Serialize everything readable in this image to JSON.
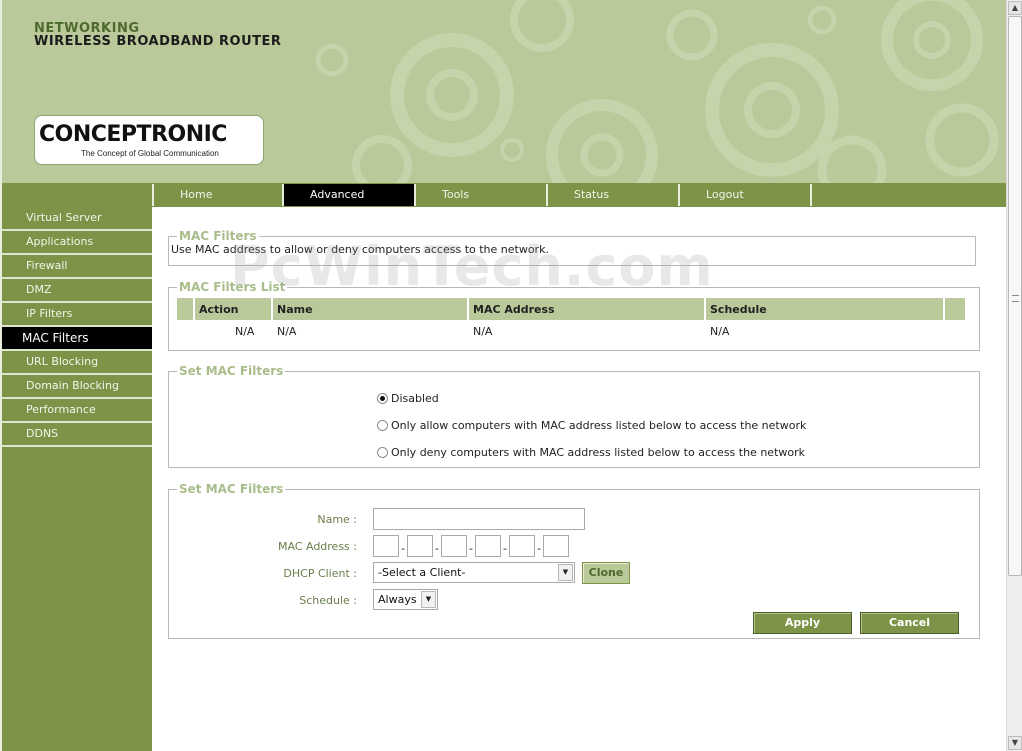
{
  "header": {
    "line1": "NETWORKING",
    "line2": "WIRELESS BROADBAND ROUTER",
    "logo_name": "CONCEPTRONIC",
    "logo_tagline": "The Concept of Global Communication"
  },
  "topnav": [
    "Home",
    "Advanced",
    "Tools",
    "Status",
    "Logout"
  ],
  "topnav_active": "Advanced",
  "sidebar": {
    "items": [
      "Virtual Server",
      "Applications",
      "Firewall",
      "DMZ",
      "IP Filters",
      "MAC Filters",
      "URL Blocking",
      "Domain Blocking",
      "Performance",
      "DDNS"
    ],
    "active": "MAC Filters"
  },
  "watermark": "PcWinTech.com",
  "mac_filters": {
    "legend": "MAC Filters",
    "description": "Use MAC address to allow or deny computers access to the network."
  },
  "list": {
    "legend": "MAC Filters List",
    "columns": [
      "Action",
      "Name",
      "MAC Address",
      "Schedule"
    ],
    "rows": [
      [
        "N/A",
        "N/A",
        "N/A",
        "N/A"
      ]
    ]
  },
  "mode": {
    "legend": "Set MAC Filters",
    "options": [
      "Disabled",
      "Only allow computers with MAC address listed below to access the network",
      "Only deny computers with MAC address listed below to access the network"
    ],
    "selected_index": 0
  },
  "form": {
    "legend": "Set MAC Filters",
    "name_label": "Name :",
    "name_value": "",
    "mac_label": "MAC Address :",
    "mac_octets": [
      "",
      "",
      "",
      "",
      "",
      ""
    ],
    "dhcp_label": "DHCP Client :",
    "dhcp_value": "-Select a Client-",
    "clone_label": "Clone",
    "schedule_label": "Schedule :",
    "schedule_value": "Always",
    "apply_label": "Apply",
    "cancel_label": "Cancel"
  },
  "colors": {
    "nav_green": "#7d9448",
    "header_green": "#b9c99a",
    "legend_green": "#a9bd8b",
    "active_black": "#000000"
  }
}
